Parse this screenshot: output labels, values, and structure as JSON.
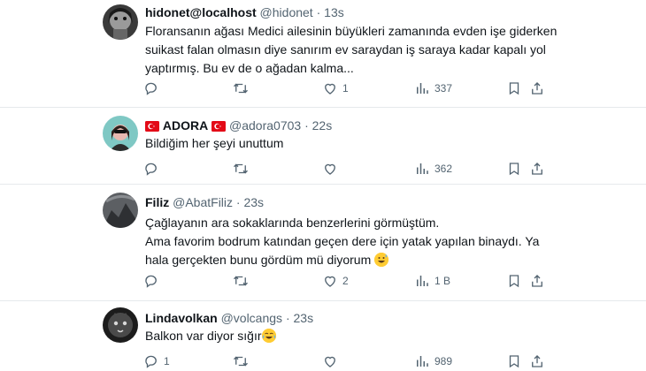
{
  "tweets": [
    {
      "name": "hidonet@localhost",
      "handle": "@hidonet",
      "time": "13s",
      "lines": [
        "Floransanın ağası Medici ailesinin büyükleri zamanında evden işe giderken",
        "suikast falan olmasın diye sanırım ev saraydan iş saraya kadar kapalı yol",
        "yaptırmış. Bu ev de o ağadan kalma..."
      ],
      "emoji": "",
      "replies": "",
      "retweets": "",
      "likes": "1",
      "views": "337"
    },
    {
      "name": "ADORA",
      "handle": "@adora0703",
      "time": "22s",
      "lines": [
        "Bildiğim her şeyi unuttum"
      ],
      "emoji": "",
      "replies": "",
      "retweets": "",
      "likes": "",
      "views": "362"
    },
    {
      "name": "Filiz",
      "handle": "@AbatFiliz",
      "time": "23s",
      "lines": [
        "Çağlayanın ara sokaklarında benzerlerini görmüştüm.",
        "Ama favorim bodrum katından geçen dere için yatak yapılan binaydı. Ya",
        "hala gerçekten bunu gördüm mü diyorum"
      ],
      "emoji": "grinning-sweat-emoji",
      "replies": "",
      "retweets": "",
      "likes": "2",
      "views": "1 B"
    },
    {
      "name": "Lindavolkan",
      "handle": "@volcangs",
      "time": "23s",
      "lines": [
        "Balkon var diyor sığır"
      ],
      "emoji": "tears-of-joy-emoji",
      "replies": "1",
      "retweets": "",
      "likes": "",
      "views": "989"
    }
  ],
  "separator": "·",
  "icons": [
    "reply-icon",
    "retweet-icon",
    "like-icon",
    "views-icon",
    "bookmark-icon",
    "share-icon",
    "turkish-flag-icon"
  ],
  "colors": {
    "text": "#0f1419",
    "muted": "#536471",
    "border": "#e6e9ec",
    "flag": "#e30a17"
  }
}
